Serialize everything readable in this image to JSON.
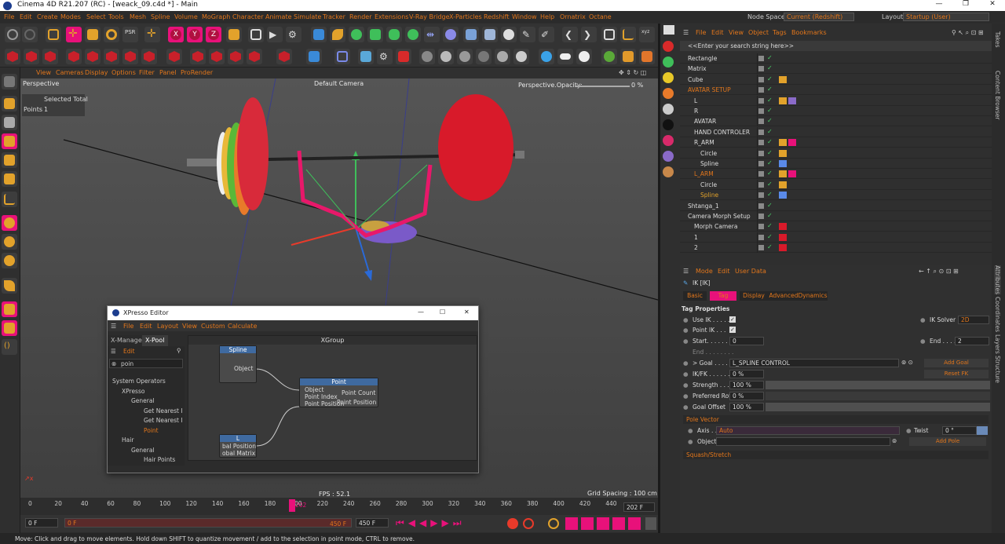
{
  "app": {
    "title": "Cinema 4D R21.207 (RC) - [weack_09.c4d *] - Main"
  },
  "menu": [
    "File",
    "Edit",
    "Create",
    "Modes",
    "Select",
    "Tools",
    "Mesh",
    "Spline",
    "Volume",
    "MoGraph",
    "Character",
    "Animate",
    "Simulate",
    "Tracker",
    "Render",
    "Extensions",
    "V-Ray Bridge",
    "X-Particles",
    "Redshift",
    "Window",
    "Help",
    "Ornatrix",
    "Octane"
  ],
  "nodespace": {
    "label": "Node Space:",
    "value": "Current (Redshift)"
  },
  "layout": {
    "label": "Layout:",
    "value": "Startup (User)"
  },
  "viewport": {
    "menu": [
      "View",
      "Cameras",
      "Display",
      "Options",
      "Filter",
      "Panel",
      "ProRender"
    ],
    "name": "Perspective",
    "camera": "Default Camera",
    "opacity_label": "Perspective.Opacity:",
    "opacity_value": "0 %",
    "stats": {
      "header": "Selected Total",
      "points_label": "Points",
      "points_value": "1"
    },
    "fps": "FPS : 52.1",
    "grid": "Grid Spacing : 100 cm"
  },
  "xpresso": {
    "title": "XPresso Editor",
    "menu": [
      "File",
      "Edit",
      "Layout",
      "View",
      "Custom",
      "Calculate"
    ],
    "tabs": [
      "X-Manager",
      "X-Pool"
    ],
    "pool_edit": "Edit",
    "search": "poin",
    "tree": [
      "System Operators",
      "XPresso",
      "General",
      "Get Nearest I",
      "Get Nearest I",
      "Point",
      "Hair",
      "General",
      "Hair Points"
    ],
    "graph_title": "XGroup",
    "nodes": {
      "spline": {
        "title": "Spline",
        "out": "Object"
      },
      "point": {
        "title": "Point",
        "in": [
          "Object",
          "Point Index",
          "Point Position"
        ],
        "out": [
          "Point Count",
          "Point Position"
        ]
      },
      "l": {
        "title": "L",
        "out": [
          "bal Position",
          "obal Matrix"
        ]
      }
    }
  },
  "timeline": {
    "ticks": [
      "0",
      "20",
      "40",
      "60",
      "80",
      "100",
      "120",
      "140",
      "160",
      "180",
      "200",
      "220",
      "240",
      "260",
      "280",
      "300",
      "320",
      "340",
      "360",
      "380",
      "400",
      "420",
      "440"
    ],
    "current": "202",
    "end_field": "202 F"
  },
  "transport": {
    "start": "0 F",
    "range_start": "0 F",
    "range_end": "450 F",
    "end": "450 F"
  },
  "status": "Move: Click and drag to move elements. Hold down SHIFT to quantize movement / add to the selection in point mode, CTRL to remove.",
  "objects": {
    "menu": [
      "File",
      "Edit",
      "View",
      "Object",
      "Tags",
      "Bookmarks"
    ],
    "search": "<<Enter your search string here>>",
    "rows": [
      {
        "name": "Rectangle",
        "indent": 0
      },
      {
        "name": "Matrix",
        "indent": 0
      },
      {
        "name": "Cube",
        "indent": 0
      },
      {
        "name": "AVATAR SETUP",
        "indent": 0,
        "color": "#e2761b"
      },
      {
        "name": "L",
        "indent": 1
      },
      {
        "name": "R",
        "indent": 1
      },
      {
        "name": "AVATAR",
        "indent": 1
      },
      {
        "name": "HAND CONTROLER",
        "indent": 1
      },
      {
        "name": "R_ARM",
        "indent": 1
      },
      {
        "name": "Circle",
        "indent": 2
      },
      {
        "name": "Spline",
        "indent": 2
      },
      {
        "name": "L_ARM",
        "indent": 1,
        "color": "#e2761b"
      },
      {
        "name": "Circle",
        "indent": 2
      },
      {
        "name": "Spline",
        "indent": 2,
        "color": "#e2a22b"
      },
      {
        "name": "Shtanga_1",
        "indent": 0
      },
      {
        "name": "Camera Morph Setup",
        "indent": 0
      },
      {
        "name": "Morph Camera",
        "indent": 1
      },
      {
        "name": "1",
        "indent": 1
      },
      {
        "name": "2",
        "indent": 1
      }
    ]
  },
  "attributes": {
    "menu": [
      "Mode",
      "Edit",
      "User Data"
    ],
    "title": "IK [IK]",
    "tabs": [
      "Basic",
      "Tag",
      "Display",
      "Advanced",
      "Dynamics"
    ],
    "section": "Tag Properties",
    "use_ik": "Use IK . . . . .",
    "ik_solver": "IK Solver",
    "ik_solver_value": "2D",
    "point_ik": "Point IK . . .",
    "start": "Start. . . . . . .",
    "start_value": "0",
    "end": "End . . . . .",
    "end_value": "2",
    "end2": "End . . . . . . . .",
    "goal": "> Goal . . . . . .",
    "goal_value": "L_SPLINE CONTROL",
    "add_goal": "Add Goal",
    "ikfk": "IK/FK . . . . . .",
    "ikfk_value": "0 %",
    "reset_fk": "Reset FK",
    "strength": "Strength . . . .",
    "strength_value": "100 %",
    "pref_rot": "Preferred Rot",
    "pref_rot_value": "0 %",
    "goal_offset": "Goal Offset",
    "goal_offset_value": "100 %",
    "pole_vector": "Pole Vector",
    "axis": "Axis . . . .",
    "axis_value": "Auto",
    "twist": "Twist",
    "twist_value": "0 °",
    "object": "Object",
    "add_pole": "Add Pole",
    "squash": "Squash/Stretch"
  },
  "side_tabs_top": [
    "Takes",
    "Content Browser"
  ],
  "side_tabs_bottom": [
    "Attributes",
    "Coordinates",
    "Layers",
    "Structure"
  ]
}
